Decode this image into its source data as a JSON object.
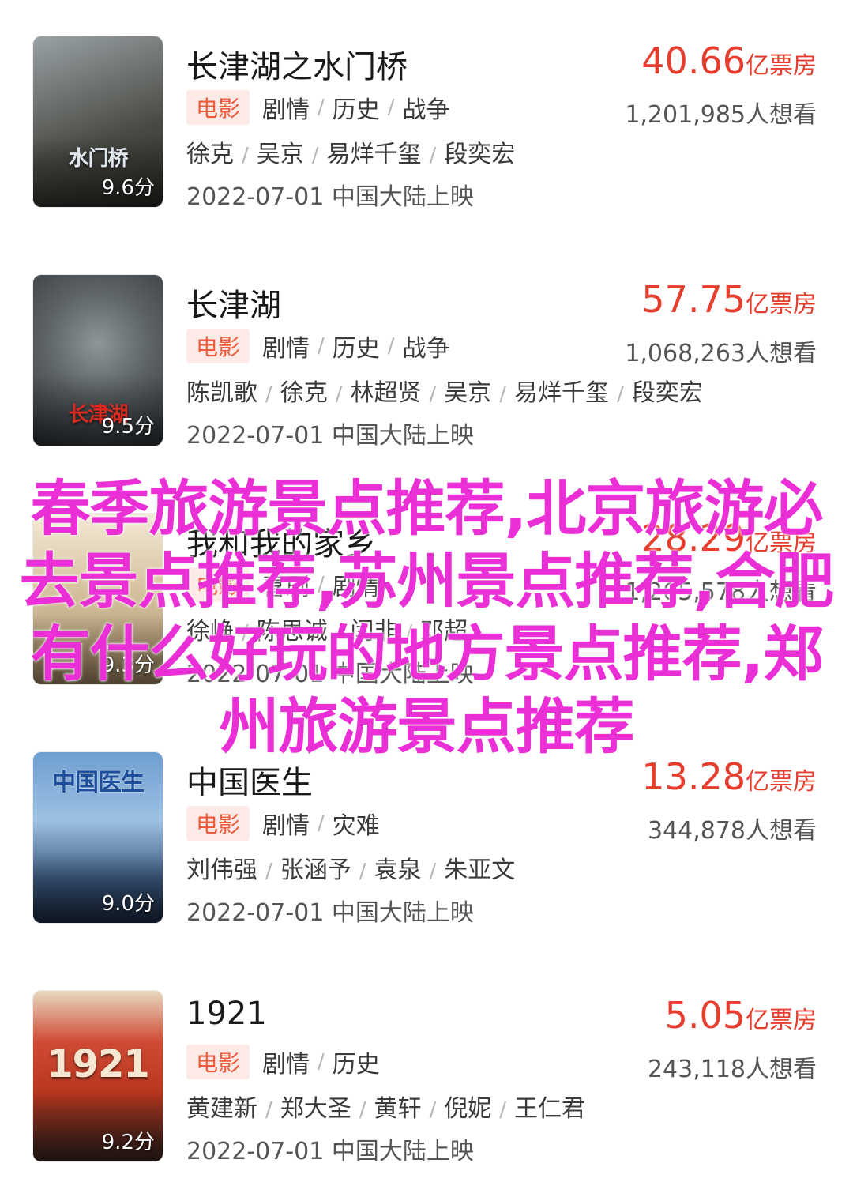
{
  "colors": {
    "accent_red": "#e63d2e",
    "tag_bg": "#fdeae6",
    "tag_text": "#ee5a3a",
    "overlay_magenta": "#ea2fd6"
  },
  "movies": [
    {
      "title": "长津湖之水门桥",
      "box_office_num": "40.66",
      "box_office_unit": "亿票房",
      "tag": "电影",
      "genres": [
        "剧情",
        "历史",
        "战争"
      ],
      "want": "1,201,985人想看",
      "cast": [
        "徐克",
        "吴京",
        "易烊千玺",
        "段奕宏"
      ],
      "release": "2022-07-01 中国大陆上映",
      "rating": "9.6分",
      "poster_text": "水门桥",
      "poster_icon": "poster-war-icon"
    },
    {
      "title": "长津湖",
      "box_office_num": "57.75",
      "box_office_unit": "亿票房",
      "tag": "电影",
      "genres": [
        "剧情",
        "历史",
        "战争"
      ],
      "want": "1,068,263人想看",
      "cast": [
        "陈凯歌",
        "徐克",
        "林超贤",
        "吴京",
        "易烊千玺",
        "段奕宏"
      ],
      "release": "2022-07-01 中国大陆上映",
      "rating": "9.5分",
      "poster_text": "长津湖",
      "poster_icon": "poster-war-icon"
    },
    {
      "title": "我和我的家乡",
      "box_office_num": "28.29",
      "box_office_unit": "亿票房",
      "tag": "电影",
      "genres": [
        "喜剧",
        "剧情"
      ],
      "want": "1,265,578人想看",
      "cast": [
        "徐峥",
        "陈思诚",
        "闫非",
        "邓超"
      ],
      "release": "2022-07-01 中国大陆上映",
      "rating": "9.3分",
      "poster_text": "",
      "poster_icon": "poster-crowd-icon"
    },
    {
      "title": "中国医生",
      "box_office_num": "13.28",
      "box_office_unit": "亿票房",
      "tag": "电影",
      "genres": [
        "剧情",
        "灾难"
      ],
      "want": "344,878人想看",
      "cast": [
        "刘伟强",
        "张涵予",
        "袁泉",
        "朱亚文"
      ],
      "release": "2022-07-01 中国大陆上映",
      "rating": "9.0分",
      "poster_text": "中国医生",
      "poster_icon": "poster-doctor-icon"
    },
    {
      "title": "1921",
      "box_office_num": "5.05",
      "box_office_unit": "亿票房",
      "tag": "电影",
      "genres": [
        "剧情",
        "历史"
      ],
      "want": "243,118人想看",
      "cast": [
        "黄建新",
        "郑大圣",
        "黄轩",
        "倪妮",
        "王仁君"
      ],
      "release": "2022-07-01 中国大陆上映",
      "rating": "9.2分",
      "poster_text": "1921",
      "poster_icon": "poster-1921-icon"
    }
  ],
  "overlay_text": "春季旅游景点推荐,北京旅游必去景点推荐,苏州景点推荐,合肥有什么好玩的地方景点推荐,郑州旅游景点推荐"
}
